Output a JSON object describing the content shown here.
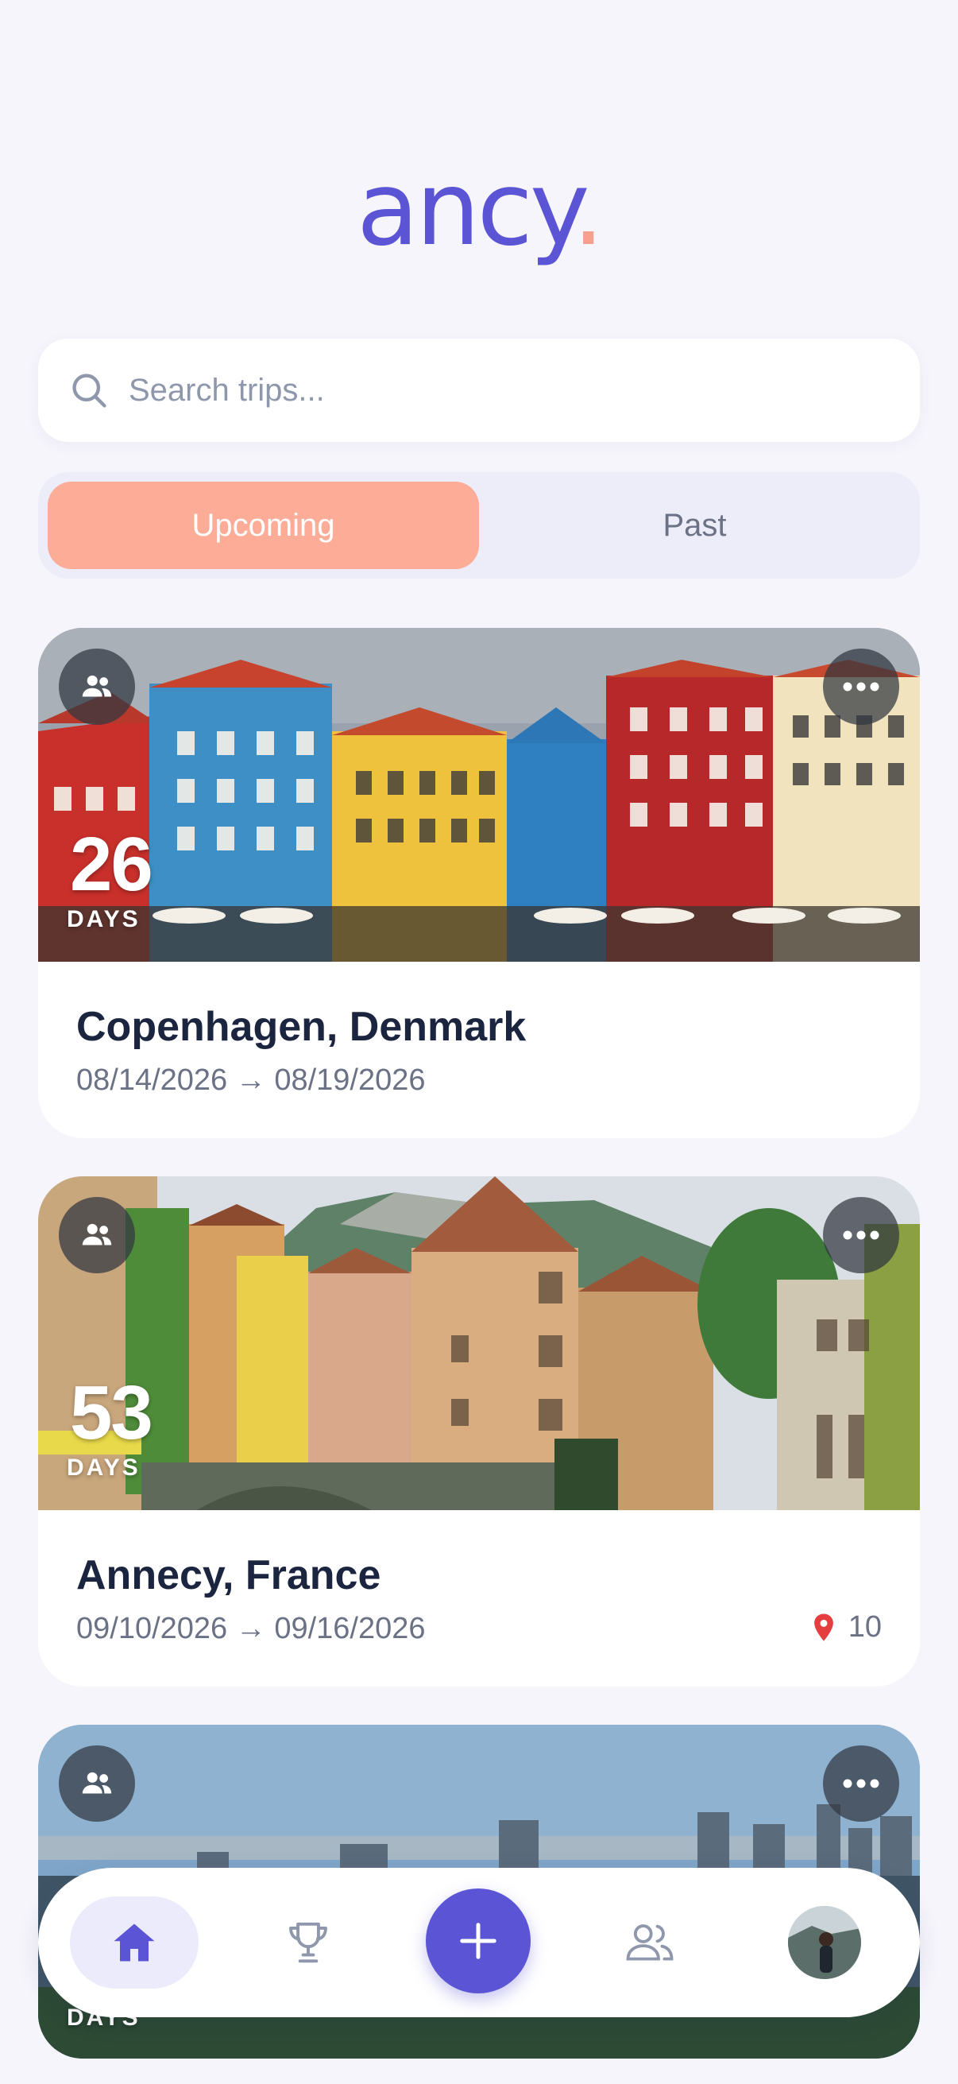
{
  "app": {
    "logo_text": "ancy",
    "logo_dot": ".",
    "brand_color": "#5b55d6",
    "accent_color": "#fcac97"
  },
  "search": {
    "placeholder": "Search trips...",
    "value": ""
  },
  "tabs": [
    {
      "label": "Upcoming",
      "active": true
    },
    {
      "label": "Past",
      "active": false
    }
  ],
  "trips": [
    {
      "title": "Copenhagen, Denmark",
      "start": "08/14/2026",
      "end": "08/19/2026",
      "arrow": "→",
      "days_count": "26",
      "days_label": "DAYS",
      "pins": ""
    },
    {
      "title": "Annecy, France",
      "start": "09/10/2026",
      "end": "09/16/2026",
      "arrow": "→",
      "days_count": "53",
      "days_label": "DAYS",
      "pins": "10"
    },
    {
      "title": "",
      "days_count": "",
      "days_label": "DAYS"
    }
  ],
  "icons": {
    "group": "group-icon",
    "more": "more-icon",
    "search": "search-icon",
    "pin": "map-pin-icon",
    "home": "home-icon",
    "trophy": "trophy-icon",
    "add": "plus-icon",
    "friends": "friends-icon"
  }
}
